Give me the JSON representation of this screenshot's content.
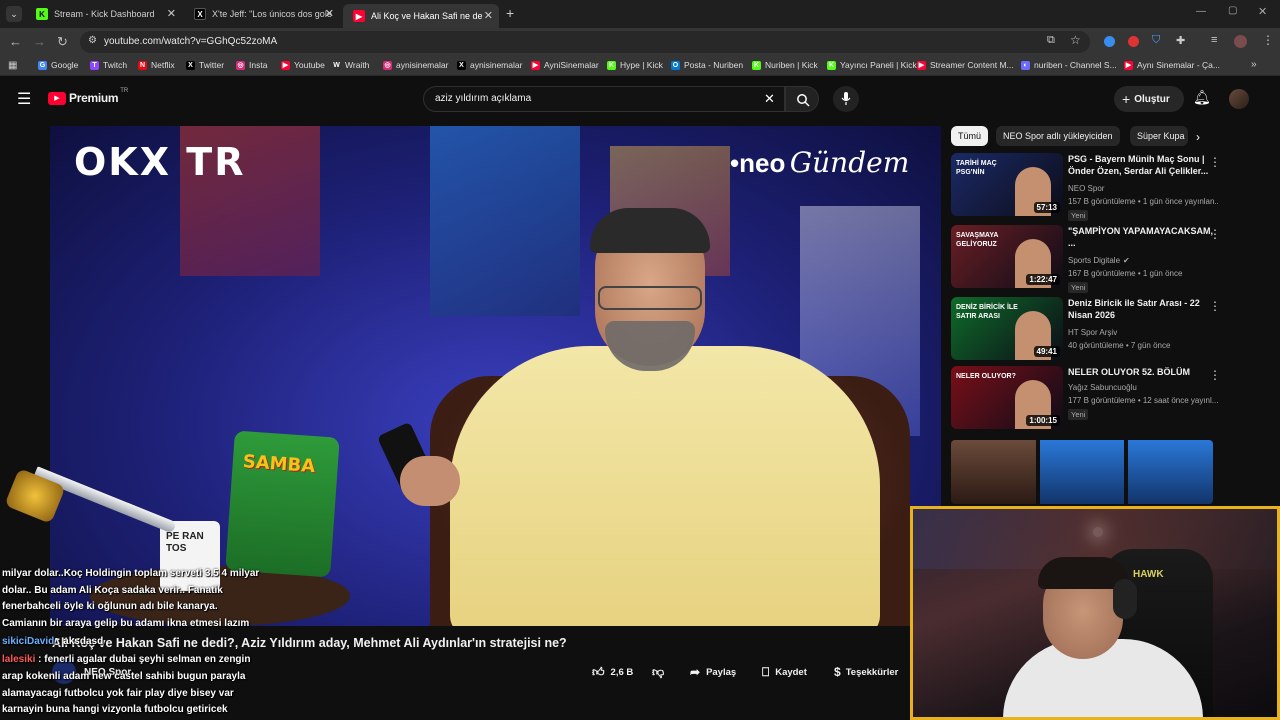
{
  "browser": {
    "tabs": [
      {
        "label": "Stream - Kick Dashboard",
        "fav": "K",
        "fav_color": "#53fc18",
        "fav_fg": "#000"
      },
      {
        "label": "X'te Jeff: \"Los únicos dos goles",
        "fav": "X",
        "fav_color": "#000",
        "fav_fg": "#fff"
      },
      {
        "label": "Ali Koç ve Hakan Safi ne dedi?,",
        "fav": "▶",
        "fav_color": "#ff0033",
        "fav_fg": "#fff"
      }
    ],
    "url": "youtube.com/watch?v=GGhQc52zoMA",
    "bookmarks": [
      {
        "label": "Google",
        "c": "#4285f4",
        "g": "G"
      },
      {
        "label": "Twitch",
        "c": "#9146ff",
        "g": "T"
      },
      {
        "label": "Netflix",
        "c": "#e50914",
        "g": "N"
      },
      {
        "label": "Twitter",
        "c": "#000",
        "g": "X"
      },
      {
        "label": "Insta",
        "c": "#d62976",
        "g": "◎"
      },
      {
        "label": "Youtube",
        "c": "#ff0033",
        "g": "▶"
      },
      {
        "label": "Wraith",
        "c": "#333",
        "g": "W"
      },
      {
        "label": "aynisinemalar",
        "c": "#d62976",
        "g": "◎"
      },
      {
        "label": "aynisinemalar",
        "c": "#000",
        "g": "X"
      },
      {
        "label": "AyniSinemalar",
        "c": "#ff0033",
        "g": "▶"
      },
      {
        "label": "Hype | Kick",
        "c": "#53fc18",
        "g": "K"
      },
      {
        "label": "Posta - Nuriben",
        "c": "#0078d4",
        "g": "O"
      },
      {
        "label": "Nuriben | Kick",
        "c": "#53fc18",
        "g": "K"
      },
      {
        "label": "Yayıncı Paneli | Kick",
        "c": "#53fc18",
        "g": "K"
      },
      {
        "label": "Streamer Content M...",
        "c": "#ff0033",
        "g": "▶"
      },
      {
        "label": "nuriben - Channel S...",
        "c": "#6b6bff",
        "g": "◐"
      },
      {
        "label": "Aynı Sinemalar - Ça...",
        "c": "#ff0033",
        "g": "▶"
      }
    ]
  },
  "youtube": {
    "logo_text": "Premium",
    "logo_sup": "TR",
    "search_value": "aziz yıldırım açıklama",
    "create_label": "Oluştur"
  },
  "video": {
    "title": "Ali Koç ve Hakan Safi ne dedi?, Aziz Yıldırım aday, Mehmet Ali Aydınlar'ın stratejisi ne?",
    "channel": "NEO Spor",
    "overlay_left": "OKX TR",
    "overlay_right_brand": "•neo",
    "overlay_right_script": "Gündem",
    "likes": "2,6 B",
    "share": "Paylaş",
    "save": "Kaydet",
    "thanks": "Teşekkürler",
    "samba": "SAMBA",
    "mug": "PE RAN TOS"
  },
  "chips": [
    "Tümü",
    "NEO Spor adlı yükleyiciden",
    "Süper Kupa"
  ],
  "recs": [
    {
      "title": "PSG - Bayern Münih Maç Sonu | Önder Özen, Serdar Ali Çelikler...",
      "channel": "NEO Spor",
      "meta": "157 B görüntüleme • 1 gün önce yayınlan...",
      "badge": "Yeni",
      "dur": "57:13",
      "bg": "#1b2a66",
      "verified": false
    },
    {
      "title": "\"ŞAMPİYON YAPAMAYACAKSAM, ...",
      "channel": "Sports Digitale",
      "meta": "167 B görüntüleme • 1 gün önce",
      "badge": "Yeni",
      "dur": "1:22:47",
      "bg": "#6a1e24",
      "verified": true
    },
    {
      "title": "Deniz Biricik ile Satır Arası - 22 Nisan 2026",
      "channel": "HT Spor Arşiv",
      "meta": "40 görüntüleme • 7 gün önce",
      "badge": "",
      "dur": "49:41",
      "bg": "#0f6b2a",
      "verified": false
    },
    {
      "title": "NELER OLUYOR 52. BÖLÜM",
      "channel": "Yağız Sabuncuoğlu",
      "meta": "177 B görüntüleme • 12 saat önce yayınl...",
      "badge": "Yeni",
      "dur": "1:00:15",
      "bg": "#7a0f18",
      "verified": false
    }
  ],
  "rec_thumb_text": [
    "TARİHİ MAÇ PSG'NİN",
    "SAVAŞMAYA GELİYORUZ",
    "DENİZ BİRİCİK İLE SATIR ARASI",
    "NELER OLUYOR?"
  ],
  "chat": [
    {
      "user": "",
      "text": "milyar dolar..Koç Holdingin toplam serveti 3.5 4 milyar"
    },
    {
      "user": "",
      "text": "dolar.. Bu adam Ali Koça sadaka verir.. Fanatik"
    },
    {
      "user": "",
      "text": "fenerbahceli öyle ki oğlunun adı bile kanarya."
    },
    {
      "user": "",
      "text": "Camianın bir araya gelip bu adamı ikna etmesi lazım"
    },
    {
      "user": "sikiciDavid",
      "text": ": aksdasd",
      "ucolor": "#6ab0ff"
    },
    {
      "user": "lalesiki",
      "text": ": fenerli agalar dubai şeyhi selman en zengin",
      "ucolor": "#ff5a5a"
    },
    {
      "user": "",
      "text": "arap kokenli adam new castel sahibi bugun parayla"
    },
    {
      "user": "",
      "text": "alamayacagi futbolcu yok fair play diye bisey var"
    },
    {
      "user": "",
      "text": "karnayin buna hangi vizyonla futbolcu getiricek"
    }
  ],
  "webcam_brand": "HAWK"
}
